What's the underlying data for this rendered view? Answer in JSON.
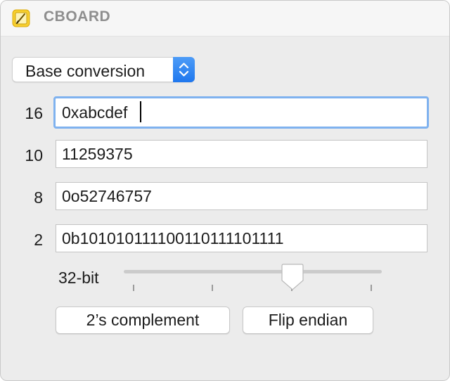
{
  "window": {
    "title": "CBOARD",
    "app_icon": "app-notepad-icon"
  },
  "mode_select": {
    "value": "Base conversion",
    "icon": "updown-chevron-icon",
    "accent_color": "#2f86f2"
  },
  "rows": [
    {
      "label": "16",
      "value": "0xabcdef"
    },
    {
      "label": "10",
      "value": "11259375"
    },
    {
      "label": "8",
      "value": "0o52746757"
    },
    {
      "label": "2",
      "value": "0b101010111100110111101111"
    }
  ],
  "bit_width": {
    "label": "32-bit",
    "tick_count": 5,
    "selected_index": 3
  },
  "buttons": {
    "twos_complement": "2’s complement",
    "flip_endian": "Flip endian"
  },
  "colors": {
    "focus_ring": "#7fb2ef",
    "window_bg": "#ececec",
    "titlebar_bg": "#f6f6f6"
  }
}
